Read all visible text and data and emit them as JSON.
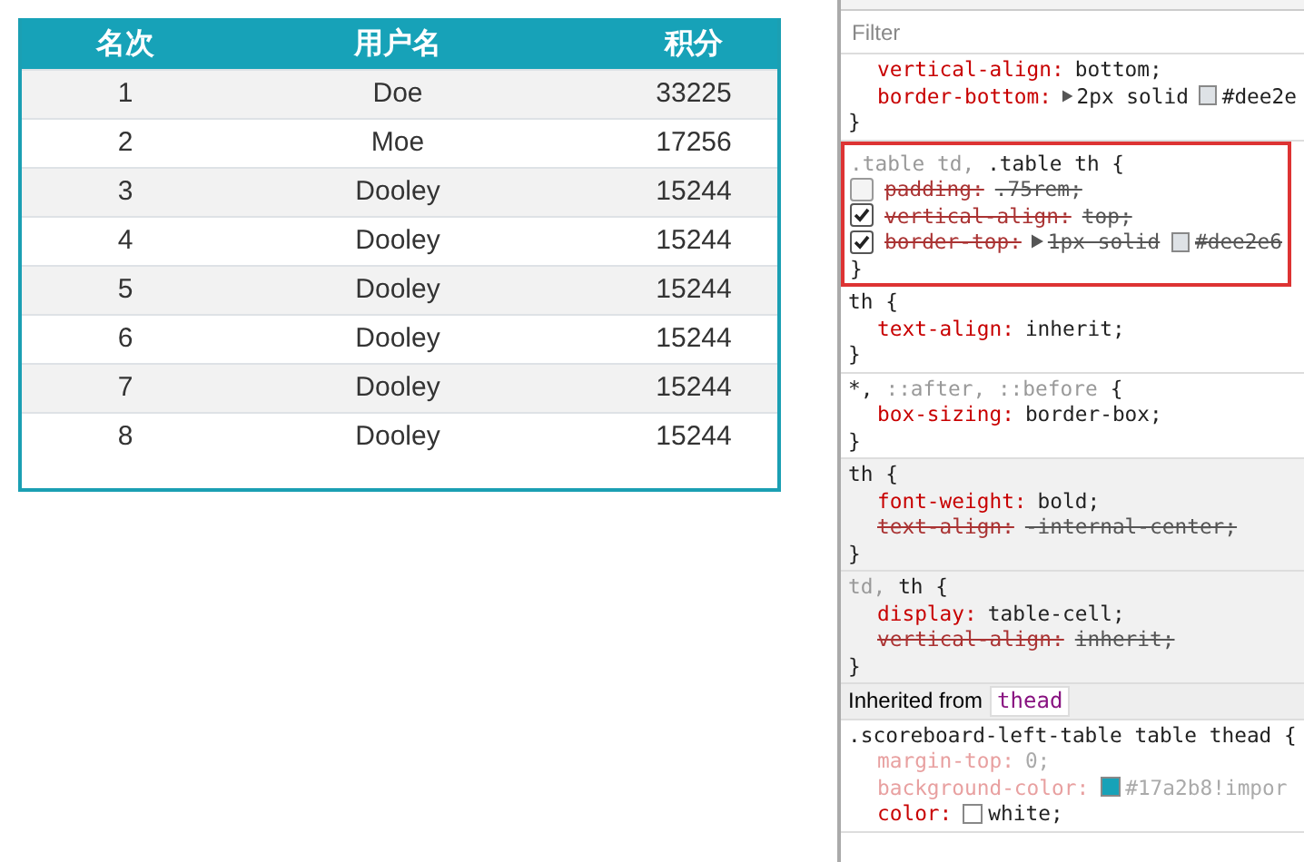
{
  "scoreboard": {
    "columns": [
      "名次",
      "用户名",
      "积分"
    ],
    "rows": [
      [
        "1",
        "Doe",
        "33225"
      ],
      [
        "2",
        "Moe",
        "17256"
      ],
      [
        "3",
        "Dooley",
        "15244"
      ],
      [
        "4",
        "Dooley",
        "15244"
      ],
      [
        "5",
        "Dooley",
        "15244"
      ],
      [
        "6",
        "Dooley",
        "15244"
      ],
      [
        "7",
        "Dooley",
        "15244"
      ],
      [
        "8",
        "Dooley",
        "15244"
      ]
    ]
  },
  "styles_panel": {
    "filter": {
      "placeholder": "Filter"
    },
    "rules": [
      {
        "highlighted": false,
        "user_agent": false,
        "close": "}",
        "properties": [
          {
            "name": "vertical-align:",
            "value": "bottom;",
            "overridden": false,
            "inactive": false
          },
          {
            "name": "border-bottom:",
            "arrow": true,
            "value": "2px solid",
            "color": "#dee2e6",
            "value_after": "#dee2e",
            "overridden": false,
            "inactive": false
          }
        ]
      },
      {
        "selector": [
          {
            "text": ".table td,",
            "matched": false
          },
          {
            "text": ".table th {",
            "matched": true
          }
        ],
        "highlighted": true,
        "user_agent": false,
        "close": "}",
        "properties": [
          {
            "name": "padding:",
            "value": ".75rem;",
            "overridden": true,
            "inactive": false,
            "checked": false
          },
          {
            "name": "vertical-align:",
            "value": "top;",
            "overridden": true,
            "inactive": false,
            "checked": true
          },
          {
            "name": "border-top:",
            "arrow": true,
            "value": "1px solid",
            "color": "#dee2e6",
            "value_after": "#dee2e6",
            "overridden": true,
            "inactive": false,
            "checked": true
          }
        ]
      },
      {
        "selector": [
          {
            "text": "th {",
            "matched": true
          }
        ],
        "highlighted": false,
        "user_agent": false,
        "close": "}",
        "properties": [
          {
            "name": "text-align:",
            "value": "inherit;",
            "overridden": false,
            "inactive": false
          }
        ]
      },
      {
        "selector": [
          {
            "text": "*,",
            "matched": true
          },
          {
            "text": "::after, ::before",
            "matched": false
          },
          {
            "text": "{",
            "matched": true
          }
        ],
        "highlighted": false,
        "user_agent": false,
        "close": "}",
        "properties": [
          {
            "name": "box-sizing:",
            "value": "border-box;",
            "overridden": false,
            "inactive": false
          }
        ]
      },
      {
        "selector": [
          {
            "text": "th {",
            "matched": true
          }
        ],
        "highlighted": false,
        "user_agent": true,
        "close": "}",
        "properties": [
          {
            "name": "font-weight:",
            "value": "bold;",
            "overridden": false,
            "inactive": false
          },
          {
            "name": "text-align:",
            "value": "-internal-center;",
            "overridden": true,
            "inactive": false
          }
        ]
      },
      {
        "selector": [
          {
            "text": "td,",
            "matched": false
          },
          {
            "text": "th {",
            "matched": true
          }
        ],
        "highlighted": false,
        "user_agent": true,
        "close": "}",
        "properties": [
          {
            "name": "display:",
            "value": "table-cell;",
            "overridden": false,
            "inactive": false
          },
          {
            "name": "vertical-align:",
            "value": "inherit;",
            "overridden": true,
            "inactive": false
          }
        ]
      }
    ],
    "inherited": {
      "label": "Inherited from",
      "tag": "thead",
      "rule": {
        "selector": [
          {
            "text": ".scoreboard-left-table table thead {",
            "matched": true
          }
        ],
        "properties": [
          {
            "name": "margin-top:",
            "value": "0;",
            "overridden": false,
            "inactive": true
          },
          {
            "name": "background-color:",
            "color": "#17a2b8",
            "value_after": "#17a2b8!impor",
            "overridden": false,
            "inactive": true
          },
          {
            "name": "color:",
            "color": "#ffffff",
            "value_after": "white;",
            "overridden": false,
            "inactive": false
          }
        ]
      }
    }
  }
}
